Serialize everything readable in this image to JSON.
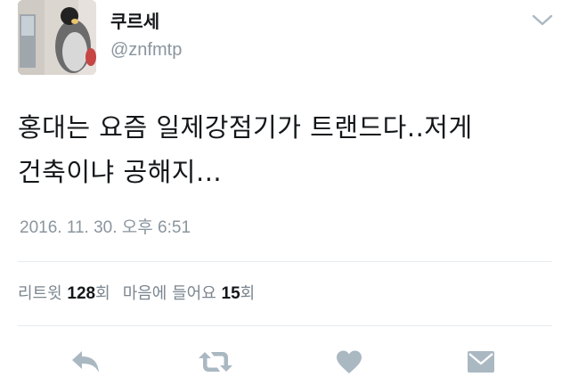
{
  "user": {
    "display_name": "쿠르세",
    "handle": "@znfmtp"
  },
  "tweet": {
    "line1": "홍대는 요즘 일제강점기가 트랜드다..저게",
    "line2": "건축이냐 공해지...",
    "timestamp": "2016. 11. 30. 오후 6:51"
  },
  "stats": {
    "retweets_label": "리트윗",
    "retweets_count": "128",
    "retweets_unit": "회",
    "likes_label": "마음에 들어요",
    "likes_count": "15",
    "likes_unit": "회"
  },
  "icons": {
    "caret": "chevron-down-icon",
    "reply": "reply-icon",
    "retweet": "retweet-icon",
    "like": "heart-icon",
    "message": "envelope-icon"
  },
  "colors": {
    "text": "#14171a",
    "secondary": "#8a959e",
    "icon": "#aab8c2",
    "divider": "#e6ecf0"
  }
}
